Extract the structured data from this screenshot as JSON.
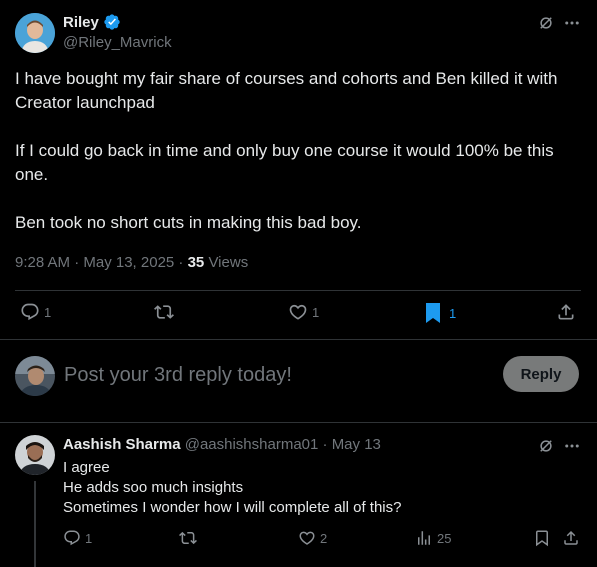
{
  "post": {
    "author": {
      "name": "Riley",
      "handle": "@Riley_Mavrick",
      "verified": true,
      "verified_color": "#1d9bf0"
    },
    "body_lines": [
      "I have bought my fair share of courses and cohorts and Ben killed it with",
      "Creator launchpad",
      "If I could go back in time and only buy one course it would 100% be this",
      "one.",
      "Ben took no short cuts in making this bad boy."
    ],
    "timestamp": "9:28 AM · May 13, 2025 · ",
    "views_count": "35",
    "views_label": " Views",
    "actions": {
      "reply_count": "1",
      "repost_count": "",
      "like_count": "1",
      "bookmark_count": "1",
      "bookmark_color": "#1d9bf0"
    }
  },
  "composer": {
    "placeholder": "Post your 3rd reply today!",
    "reply_button": "Reply"
  },
  "reply": {
    "author": {
      "name": "Aashish Sharma",
      "handle": "@aashishsharma01",
      "date": " · May 13"
    },
    "body_lines": [
      "I agree",
      "He adds soo much insights",
      "Sometimes I wonder how I will complete all of this?"
    ],
    "actions": {
      "reply_count": "1",
      "repost_count": "",
      "like_count": "2",
      "views_count": "25"
    }
  },
  "icons": {
    "grok": "grok-icon",
    "more": "more-icon",
    "reply": "reply-icon",
    "repost": "repost-icon",
    "like": "heart-icon",
    "bookmark": "bookmark-icon",
    "share": "share-icon",
    "views": "views-icon"
  },
  "colors": {
    "background": "#000000",
    "text": "#e7e9ea",
    "muted": "#71767b",
    "accent": "#1d9bf0",
    "reply_button_bg": "#787a7a"
  }
}
